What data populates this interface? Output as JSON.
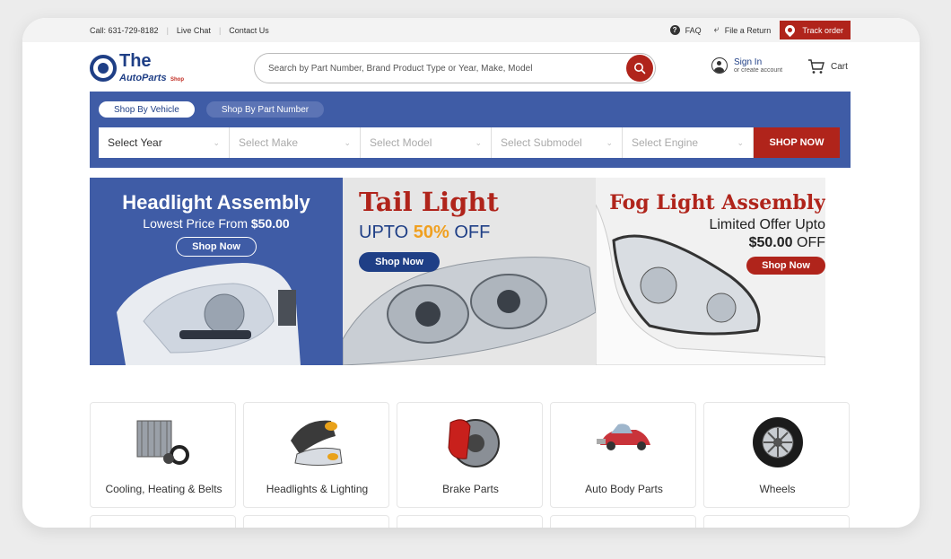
{
  "topbar": {
    "call": "Call: 631-729-8182",
    "live_chat": "Live Chat",
    "contact": "Contact Us",
    "faq": "FAQ",
    "file_return": "File a Return",
    "track_order": "Track order"
  },
  "header": {
    "logo_the": "The",
    "logo_autoparts": "AutoParts",
    "logo_shop": "Shop",
    "search_placeholder": "Search by Part Number, Brand Product Type or Year, Make, Model",
    "sign_in": "Sign In",
    "create_account": "or create account",
    "cart": "Cart"
  },
  "shop_by": {
    "tabs": [
      "Shop By Vehicle",
      "Shop By Part Number"
    ],
    "selects": [
      "Select Year",
      "Select Make",
      "Select Model",
      "Select Submodel",
      "Select Engine"
    ],
    "shop_now": "SHOP NOW"
  },
  "banners": [
    {
      "title": "Headlight Assembly",
      "subtitle_prefix": "Lowest Price From",
      "subtitle_price": "$50.00",
      "button": "Shop Now"
    },
    {
      "title": "Tail Light",
      "subtitle_prefix": "UPTO",
      "subtitle_pct": "50%",
      "subtitle_suffix": "OFF",
      "button": "Shop Now"
    },
    {
      "title": "Fog Light Assembly",
      "line1": "Limited Offer Upto",
      "price": "$50.00",
      "price_suffix": "OFF",
      "button": "Shop Now"
    }
  ],
  "categories": [
    {
      "label": "Cooling, Heating & Belts",
      "icon": "radiator-icon"
    },
    {
      "label": "Headlights & Lighting",
      "icon": "headlight-icon"
    },
    {
      "label": "Brake Parts",
      "icon": "brake-icon"
    },
    {
      "label": "Auto Body Parts",
      "icon": "car-body-icon"
    },
    {
      "label": "Wheels",
      "icon": "wheel-icon"
    }
  ],
  "colors": {
    "brand_blue": "#3f5ca6",
    "brand_red": "#b0241b",
    "accent_orange": "#f0a020"
  }
}
